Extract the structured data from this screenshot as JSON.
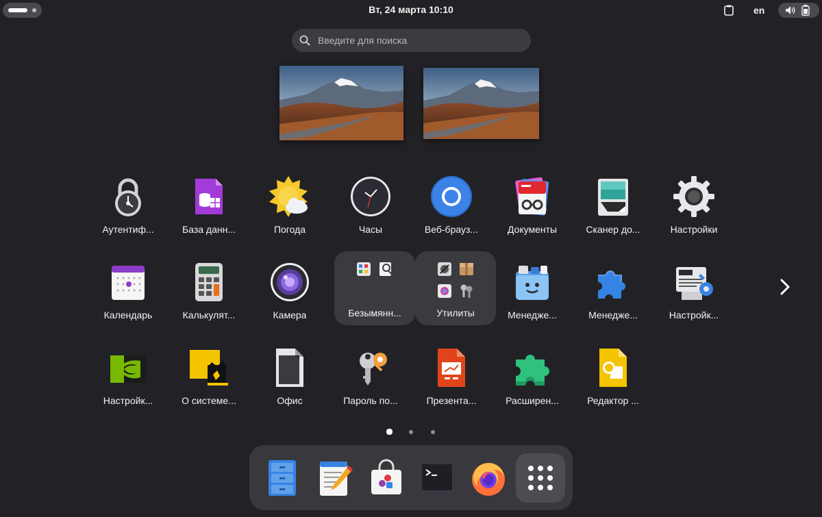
{
  "topbar": {
    "clock": "Вт, 24 марта  10:10",
    "language": "en",
    "icons": [
      "activities-indicator",
      "clipboard-icon",
      "speaker-icon",
      "battery-icon"
    ]
  },
  "search": {
    "placeholder": "Введите для поиска",
    "value": ""
  },
  "workspaces": [
    {
      "name": "workspace-1",
      "wallpaper": "mountain-landscape"
    },
    {
      "name": "workspace-2",
      "wallpaper": "mountain-landscape"
    }
  ],
  "apps": {
    "row1": [
      {
        "label": "Аутентиф...",
        "icon": "padlock-icon"
      },
      {
        "label": "База данн...",
        "icon": "database-icon"
      },
      {
        "label": "Погода",
        "icon": "weather-icon"
      },
      {
        "label": "Часы",
        "icon": "clock-icon"
      },
      {
        "label": "Веб-брауз...",
        "icon": "web-browser-icon"
      },
      {
        "label": "Документы",
        "icon": "documents-icon"
      },
      {
        "label": "Сканер до...",
        "icon": "scanner-icon"
      },
      {
        "label": "Настройки",
        "icon": "settings-gear-icon"
      }
    ],
    "row2": [
      {
        "label": "Календарь",
        "icon": "calendar-icon"
      },
      {
        "label": "Калькулят...",
        "icon": "calculator-icon"
      },
      {
        "label": "Камера",
        "icon": "camera-icon"
      },
      {
        "label": "Безымянн...",
        "icon": "folder-icon"
      },
      {
        "label": "Утилиты",
        "icon": "folder-icon"
      },
      {
        "label": "Менедже...",
        "icon": "file-manager-icon"
      },
      {
        "label": "Менедже...",
        "icon": "extensions-puzzle-icon"
      },
      {
        "label": "Настройк...",
        "icon": "system-settings-icon"
      }
    ],
    "row3": [
      {
        "label": "Настройк...",
        "icon": "nvidia-icon"
      },
      {
        "label": "О системе...",
        "icon": "basealt-icon"
      },
      {
        "label": "Офис",
        "icon": "office-icon"
      },
      {
        "label": "Пароль по...",
        "icon": "password-key-icon"
      },
      {
        "label": "Презента...",
        "icon": "presentation-icon"
      },
      {
        "label": "Расширен...",
        "icon": "green-puzzle-icon"
      },
      {
        "label": "Редактор ...",
        "icon": "drawing-editor-icon"
      }
    ]
  },
  "pager": {
    "pages": 3,
    "current": 1
  },
  "dock": [
    {
      "name": "files",
      "icon": "file-cabinet-icon"
    },
    {
      "name": "text-editor",
      "icon": "text-editor-icon"
    },
    {
      "name": "software-center",
      "icon": "shopping-bag-icon"
    },
    {
      "name": "terminal",
      "icon": "terminal-icon"
    },
    {
      "name": "firefox",
      "icon": "firefox-icon"
    },
    {
      "name": "show-apps",
      "icon": "app-grid-icon"
    }
  ],
  "colors": {
    "background": "#222226",
    "panel": "#38383d",
    "folder": "#3a3a3f",
    "accent_blue": "#3584e4"
  }
}
